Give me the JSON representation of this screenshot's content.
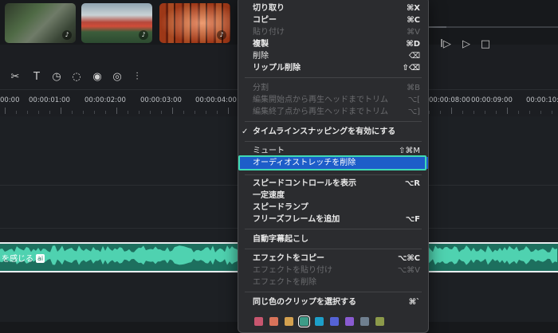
{
  "media": {
    "thumbnails": [
      {
        "name": "forest-aerial",
        "badge": "♪"
      },
      {
        "name": "torii-gate",
        "badge": "♪"
      },
      {
        "name": "torii-tunnel",
        "badge": "♪"
      }
    ]
  },
  "progress": 0.15,
  "playback": {
    "frame_forward": "I▷",
    "play": "▷",
    "stop": "□"
  },
  "toolbar_icons": [
    "scissors-icon",
    "text-icon",
    "timer-icon",
    "mask-icon",
    "audio-sync-icon",
    "speed-icon",
    "waveform-icon"
  ],
  "ruler": {
    "labels": [
      "00:00",
      "00:00:01:00",
      "00:00:02:00",
      "00:00:03:00",
      "00:00:04:00",
      "00:00:08:00",
      "00:00:09:00",
      "00:00:10:00"
    ]
  },
  "audio_clip": {
    "label": "を感じる",
    "chip": "ai"
  },
  "menu": {
    "items": [
      {
        "label": "切り取り",
        "shortcut": "⌘X",
        "state": "bold"
      },
      {
        "label": "コピー",
        "shortcut": "⌘C",
        "state": "bold"
      },
      {
        "label": "貼り付け",
        "shortcut": "⌘V",
        "state": "disabled"
      },
      {
        "label": "複製",
        "shortcut": "⌘D",
        "state": "bold"
      },
      {
        "label": "削除",
        "shortcut": "⌫",
        "state": "normal"
      },
      {
        "label": "リップル削除",
        "shortcut": "⇧⌫",
        "state": "bold"
      },
      {
        "label": "分割",
        "shortcut": "⌘B",
        "state": "disabled"
      },
      {
        "label": "編集開始点から再生ヘッドまでトリム",
        "shortcut": "⌥[",
        "state": "disabled"
      },
      {
        "label": "編集終了点から再生ヘッドまでトリム",
        "shortcut": "⌥]",
        "state": "disabled"
      },
      {
        "label": "タイムラインスナッピングを有効にする",
        "shortcut": "",
        "state": "checked"
      },
      {
        "label": "ミュート",
        "shortcut": "⇧⌘M",
        "state": "normal"
      },
      {
        "label": "オーディオストレッチを削除",
        "shortcut": "",
        "state": "highlighted"
      },
      {
        "label": "スピードコントロールを表示",
        "shortcut": "⌥R",
        "state": "bold"
      },
      {
        "label": "一定速度",
        "shortcut": "",
        "state": "bold"
      },
      {
        "label": "スピードランプ",
        "shortcut": "",
        "state": "bold"
      },
      {
        "label": "フリーズフレームを追加",
        "shortcut": "⌥F",
        "state": "bold"
      },
      {
        "label": "自動字幕起こし",
        "shortcut": "",
        "state": "bold"
      },
      {
        "label": "エフェクトをコピー",
        "shortcut": "⌥⌘C",
        "state": "bold"
      },
      {
        "label": "エフェクトを貼り付け",
        "shortcut": "⌥⌘V",
        "state": "disabled"
      },
      {
        "label": "エフェクトを削除",
        "shortcut": "",
        "state": "disabled"
      },
      {
        "label": "同じ色のクリップを選択する",
        "shortcut": "⌘`",
        "state": "bold"
      }
    ],
    "colors": [
      "#c8566f",
      "#d9735a",
      "#d4a14f",
      "#3d9c88",
      "#1d9fc9",
      "#5563d6",
      "#8a5bd1",
      "#6f7f8f",
      "#8c9a4a"
    ],
    "selected_color": 3
  }
}
